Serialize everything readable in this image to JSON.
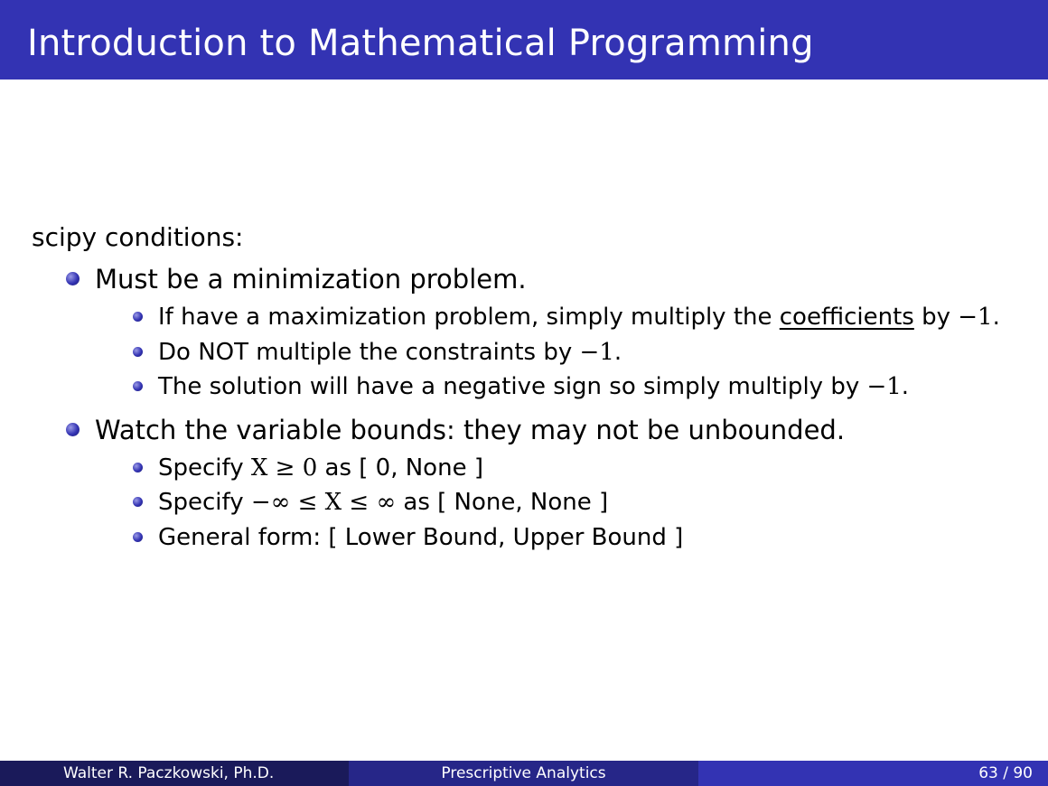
{
  "slide": {
    "title": "Introduction to Mathematical Programming",
    "intro": "scipy conditions:",
    "bullets": [
      {
        "text": "Must be a minimization problem.",
        "sub": [
          {
            "pre": "If have a maximization problem, simply multiply the ",
            "emph": "coefficients",
            "post": " by ",
            "math": "−1",
            "end": "."
          },
          {
            "pre": "Do NOT multiple the constraints by ",
            "math": "−1",
            "end": "."
          },
          {
            "pre": "The solution will have a negative sign so simply multiply by ",
            "math": "−1",
            "end": "."
          }
        ]
      },
      {
        "text": "Watch the variable bounds: they may not be unbounded.",
        "sub": [
          {
            "pre": "Specify ",
            "math": "X ≥ 0",
            "post": " as [ 0, None ]"
          },
          {
            "pre": "Specify ",
            "math": "−∞ ≤ X ≤ ∞",
            "post": " as [ None, None ]"
          },
          {
            "pre": "General form: [ Lower Bound, Upper Bound ]"
          }
        ]
      }
    ]
  },
  "footer": {
    "author": "Walter R. Paczkowski, Ph.D.",
    "course": "Prescriptive Analytics",
    "page": "63 / 90"
  },
  "colors": {
    "header": "#3333b3",
    "footer_left": "#1a1a5a",
    "footer_mid": "#262688",
    "footer_right": "#3333b3"
  }
}
